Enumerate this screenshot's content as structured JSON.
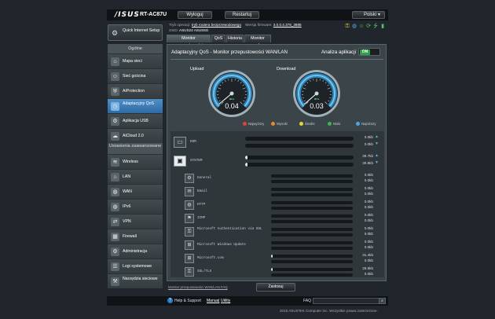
{
  "header": {
    "logo": "/ISUS",
    "model": "RT-AC87U",
    "logout_label": "Wyloguj",
    "restart_label": "Restartuj",
    "language": "Polski"
  },
  "info": {
    "mode_label": "Tryb operacji:",
    "mode_value": "tryb routera bezprzewodowego",
    "firmware_label": "Wersja firmware:",
    "firmware_value": "3.0.0.4.378_3885",
    "ssid_label": "SSID:",
    "ssid_1": "ASUS24",
    "ssid_2": "ASUS5G"
  },
  "sidebar": {
    "quick_setup": "Quick Internet Setup",
    "section1_title": "Ogólne",
    "section1_items": [
      {
        "label": "Mapa sieci",
        "icon": "network-map-icon",
        "glyph": "⌂"
      },
      {
        "label": "Sieć gościna",
        "icon": "guest-network-icon",
        "glyph": "☺"
      },
      {
        "label": "AiProtection",
        "icon": "aiprotection-icon",
        "glyph": "⛨"
      },
      {
        "label": "Adaptacyjny QoS",
        "icon": "qos-icon",
        "glyph": "◷"
      },
      {
        "label": "Aplikacja USB",
        "icon": "usb-app-icon",
        "glyph": "⚙"
      },
      {
        "label": "AiCloud 2.0",
        "icon": "aicloud-icon",
        "glyph": "☁"
      }
    ],
    "section2_title": "Ustawienia zaawansowane",
    "section2_items": [
      {
        "label": "Wireless",
        "icon": "wireless-icon",
        "glyph": "≋"
      },
      {
        "label": "LAN",
        "icon": "lan-icon",
        "glyph": "⌂"
      },
      {
        "label": "WAN",
        "icon": "wan-icon",
        "glyph": "◍"
      },
      {
        "label": "IPv6",
        "icon": "ipv6-icon",
        "glyph": "◍"
      },
      {
        "label": "VPN",
        "icon": "vpn-icon",
        "glyph": "⇄"
      },
      {
        "label": "Firewall",
        "icon": "firewall-icon",
        "glyph": "▦"
      },
      {
        "label": "Administracja",
        "icon": "administration-icon",
        "glyph": "⚙"
      },
      {
        "label": "Logi systemowe",
        "icon": "system-log-icon",
        "glyph": "☰"
      },
      {
        "label": "Narzędzia sieciowe",
        "icon": "network-tools-icon",
        "glyph": "⚒"
      }
    ]
  },
  "tabs": [
    "Monitor przepustowości",
    "QoS",
    "Historia",
    "Monitor ruchu"
  ],
  "main": {
    "title": "Adaptacyjny QoS - Monitor przepustowości WAN/LAN",
    "app_analysis_label": "Analiza aplikacji",
    "toggle_state": "ON",
    "upload_label": "Upload",
    "download_label": "Download",
    "upload_value": "0.04",
    "download_value": "0.03",
    "upload_ratio": 0.02,
    "download_ratio": 0.015,
    "gauge_unit": "Mb/s",
    "legend": [
      {
        "label": "Najwyższy",
        "color": "#d9443f"
      },
      {
        "label": "Wysoki",
        "color": "#e58a2a"
      },
      {
        "label": "Średni",
        "color": "#e8d43a"
      },
      {
        "label": "Niski",
        "color": "#3fb34f"
      },
      {
        "label": "Najniższy",
        "color": "#4ea7dc"
      }
    ]
  },
  "devices": [
    {
      "name": "DOM",
      "rate_up": "0.0kb",
      "rate_down": "0.0kb",
      "fill_up": 0.0,
      "fill_down": 0.0,
      "expanded": false
    },
    {
      "name": "SYSTEM",
      "rate_up": "39.7kb",
      "rate_down": "30.8kb",
      "fill_up": 0.01,
      "fill_down": 0.01,
      "expanded": true
    }
  ],
  "apps": [
    {
      "name": "General",
      "rate": "0.0kb",
      "fill": 0.0
    },
    {
      "name": "Email",
      "rate": "0.0kb",
      "fill": 0.0
    },
    {
      "name": "HTTP",
      "rate": "0.0kb",
      "fill": 0.0
    },
    {
      "name": "ICMP",
      "rate": "0.0kb",
      "fill": 0.0
    },
    {
      "name": "Microsoft Authentication via SSL",
      "rate": "0.0kb",
      "fill": 0.0
    },
    {
      "name": "Microsoft Windows Update",
      "rate": "0.0kb",
      "fill": 0.0
    },
    {
      "name": "Microsoft.com",
      "rate": "31.4kb",
      "fill": 0.01
    },
    {
      "name": "SSL/TLS",
      "rate": "26.9kb",
      "fill": 0.01
    }
  ],
  "app_extra_rates": [
    "0.0kb",
    "0.0kb",
    "0.0kb",
    "0.0kb",
    "0.0kb",
    "0.0kb",
    "0.0kb",
    "0.0kb"
  ],
  "bottom": {
    "link": "Monitor przepustowości WAN/LAN FAQ",
    "apply": "Zastosuj"
  },
  "footer": {
    "help": "Help & Support",
    "manual": "Manual",
    "sep": "|",
    "utility": "Utility",
    "faq": "FAQ",
    "copyright": "2015 ASUSTeK Computer Inc. Wszystkie prawa zastrzeżone."
  }
}
